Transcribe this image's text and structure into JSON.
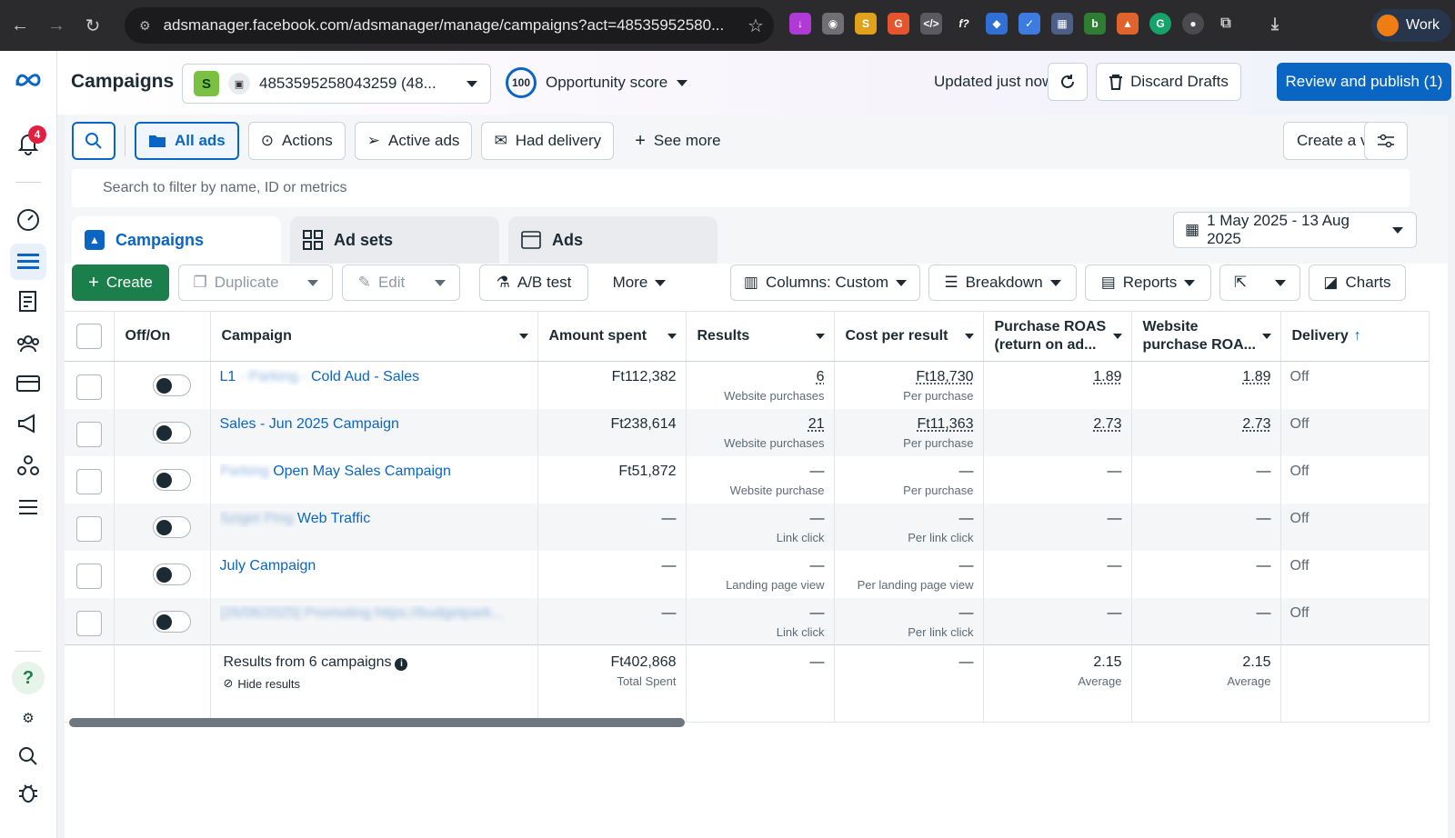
{
  "browser": {
    "url": "adsmanager.facebook.com/adsmanager/manage/campaigns?act=48535952580...",
    "profile_label": "Work"
  },
  "rail": {
    "notification_count": "4"
  },
  "header": {
    "title": "Campaigns",
    "account_badge": "S",
    "account_id": "4853595258043259 (48...",
    "opportunity_value": "100",
    "opportunity_label": "Opportunity score",
    "updated_text": "Updated just now",
    "discard_label": "Discard Drafts",
    "publish_label": "Review and publish (1)"
  },
  "filters": {
    "all_ads": "All ads",
    "actions": "Actions",
    "active_ads": "Active ads",
    "had_delivery": "Had delivery",
    "see_more": "See more",
    "create_view": "Create a view",
    "search_placeholder": "Search to filter by name, ID or metrics"
  },
  "tabs": {
    "campaigns": "Campaigns",
    "ad_sets": "Ad sets",
    "ads": "Ads"
  },
  "date_range": "1 May 2025 - 13 Aug 2025",
  "toolbar": {
    "create": "Create",
    "duplicate": "Duplicate",
    "edit": "Edit",
    "ab_test": "A/B test",
    "more": "More",
    "columns": "Columns: Custom",
    "breakdown": "Breakdown",
    "reports": "Reports",
    "charts": "Charts"
  },
  "table": {
    "headers": {
      "offon": "Off/On",
      "campaign": "Campaign",
      "amount": "Amount spent",
      "results": "Results",
      "cpr": "Cost per result",
      "proas": "Purchase ROAS (return on ad...",
      "wproas": "Website purchase ROA...",
      "delivery": "Delivery"
    },
    "rows": [
      {
        "name_blur": "",
        "name_prefix": "L1 ",
        "name_hidden": "- Parking -",
        "name_rest": " Cold Aud - Sales",
        "amount": "Ft112,382",
        "results": "6",
        "results_sub": "Website purchases",
        "cpr": "Ft18,730",
        "cpr_sub": "Per purchase",
        "proas": "1.89",
        "wproas": "1.89",
        "delivery": "Off"
      },
      {
        "name_prefix": "",
        "name_hidden": "",
        "name_rest": "Sales - Jun 2025 Campaign",
        "amount": "Ft238,614",
        "results": "21",
        "results_sub": "Website purchases",
        "cpr": "Ft11,363",
        "cpr_sub": "Per purchase",
        "proas": "2.73",
        "wproas": "2.73",
        "delivery": "Off"
      },
      {
        "name_prefix": "",
        "name_hidden": "Parking",
        "name_rest": " Open May Sales Campaign",
        "amount": "Ft51,872",
        "results": "—",
        "results_sub": "Website purchase",
        "cpr": "—",
        "cpr_sub": "Per purchase",
        "proas": "—",
        "wproas": "—",
        "delivery": "Off"
      },
      {
        "name_prefix": "",
        "name_hidden": "Sziget Ping",
        "name_rest": " Web Traffic",
        "amount": "—",
        "results": "—",
        "results_sub": "Link click",
        "cpr": "—",
        "cpr_sub": "Per link click",
        "proas": "—",
        "wproas": "—",
        "delivery": "Off"
      },
      {
        "name_prefix": "",
        "name_hidden": "",
        "name_rest": "July Campaign",
        "amount": "—",
        "results": "—",
        "results_sub": "Landing page view",
        "cpr": "—",
        "cpr_sub": "Per landing page view",
        "proas": "—",
        "wproas": "—",
        "delivery": "Off"
      },
      {
        "name_prefix": "",
        "name_hidden": "[26/06/2025] Promoting https://budgetpark...",
        "name_rest": "",
        "amount": "—",
        "results": "—",
        "results_sub": "Link click",
        "cpr": "—",
        "cpr_sub": "Per link click",
        "proas": "—",
        "wproas": "—",
        "delivery": "Off"
      }
    ],
    "summary": {
      "label": "Results from 6 campaigns",
      "hide": "Hide results",
      "amount": "Ft402,868",
      "amount_sub": "Total Spent",
      "results": "—",
      "cpr": "—",
      "proas": "2.15",
      "proas_sub": "Average",
      "wproas": "2.15",
      "wproas_sub": "Average"
    }
  }
}
